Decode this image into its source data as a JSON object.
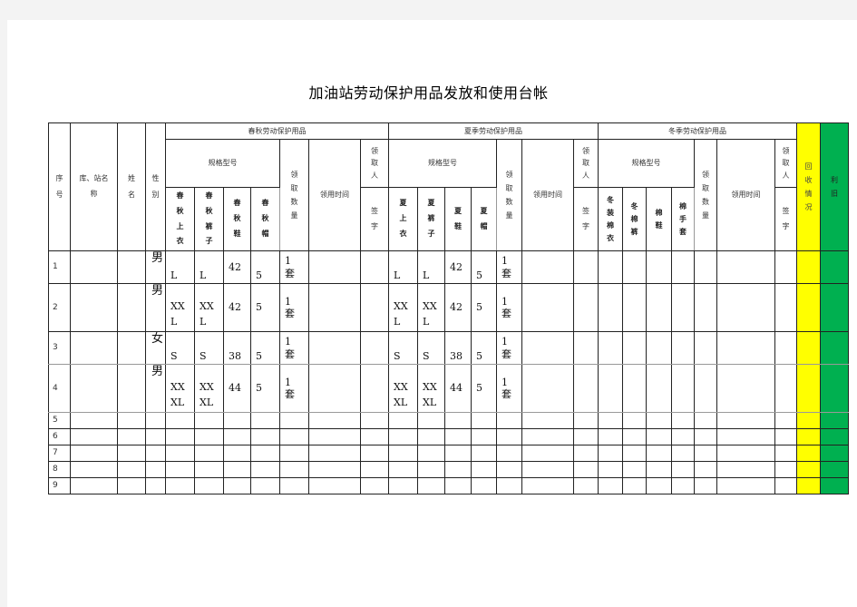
{
  "title": "加油站劳动保护用品发放和使用台帐",
  "headers": {
    "seq": "序号",
    "depot": "库、站名称",
    "name": "姓名",
    "sex": "性别",
    "spring_autumn": {
      "group": "春秋劳动保护用品",
      "spec": "规格型号",
      "items": [
        "春秋上衣",
        "春秋裤子",
        "春秋鞋",
        "春秋帽"
      ],
      "qty": "领取数量",
      "time": "领用时间",
      "receiver": "领取人",
      "sign": "签字"
    },
    "summer": {
      "group": "夏季劳动保护用品",
      "spec": "规格型号",
      "items": [
        "夏上衣",
        "夏裤子",
        "夏鞋",
        "夏帽"
      ],
      "qty": "领取数量",
      "time": "领用时间",
      "receiver": "领取人",
      "sign": "签字"
    },
    "winter": {
      "group": "冬季劳动保护用品",
      "spec": "规格型号",
      "items": [
        "冬装棉衣",
        "冬棉裤",
        "棉鞋",
        "棉手套"
      ],
      "qty": "领取数量",
      "time": "领用时间",
      "receiver": "领取人",
      "sign": "签字"
    },
    "recycle": "回收情况",
    "scrap": "利旧"
  },
  "colors": {
    "recycle_col": "#ffff00",
    "scrap_col": "#00b050"
  },
  "rows": [
    {
      "seq": "1",
      "sex": "男",
      "sa": [
        "L",
        "L",
        "42",
        "5"
      ],
      "sa_qty": "1套",
      "su": [
        "L",
        "L",
        "42",
        "5"
      ],
      "su_qty": "1套"
    },
    {
      "seq": "2",
      "sex": "男",
      "sa": [
        "XXL",
        "XXL",
        "42",
        "5"
      ],
      "sa_qty": "1套",
      "su": [
        "XXL",
        "XXL",
        "42",
        "5"
      ],
      "su_qty": "1套"
    },
    {
      "seq": "3",
      "sex": "女",
      "sa": [
        "S",
        "S",
        "38",
        "5"
      ],
      "sa_qty": "1套",
      "su": [
        "S",
        "S",
        "38",
        "5"
      ],
      "su_qty": "1套"
    },
    {
      "seq": "4",
      "sex": "男",
      "sa": [
        "XXXL",
        "XXXL",
        "44",
        "5"
      ],
      "sa_qty": "1套",
      "su": [
        "XXXL",
        "XXXL",
        "44",
        "5"
      ],
      "su_qty": "1套"
    },
    {
      "seq": "5"
    },
    {
      "seq": "6"
    },
    {
      "seq": "7"
    },
    {
      "seq": "8"
    },
    {
      "seq": "9"
    }
  ]
}
